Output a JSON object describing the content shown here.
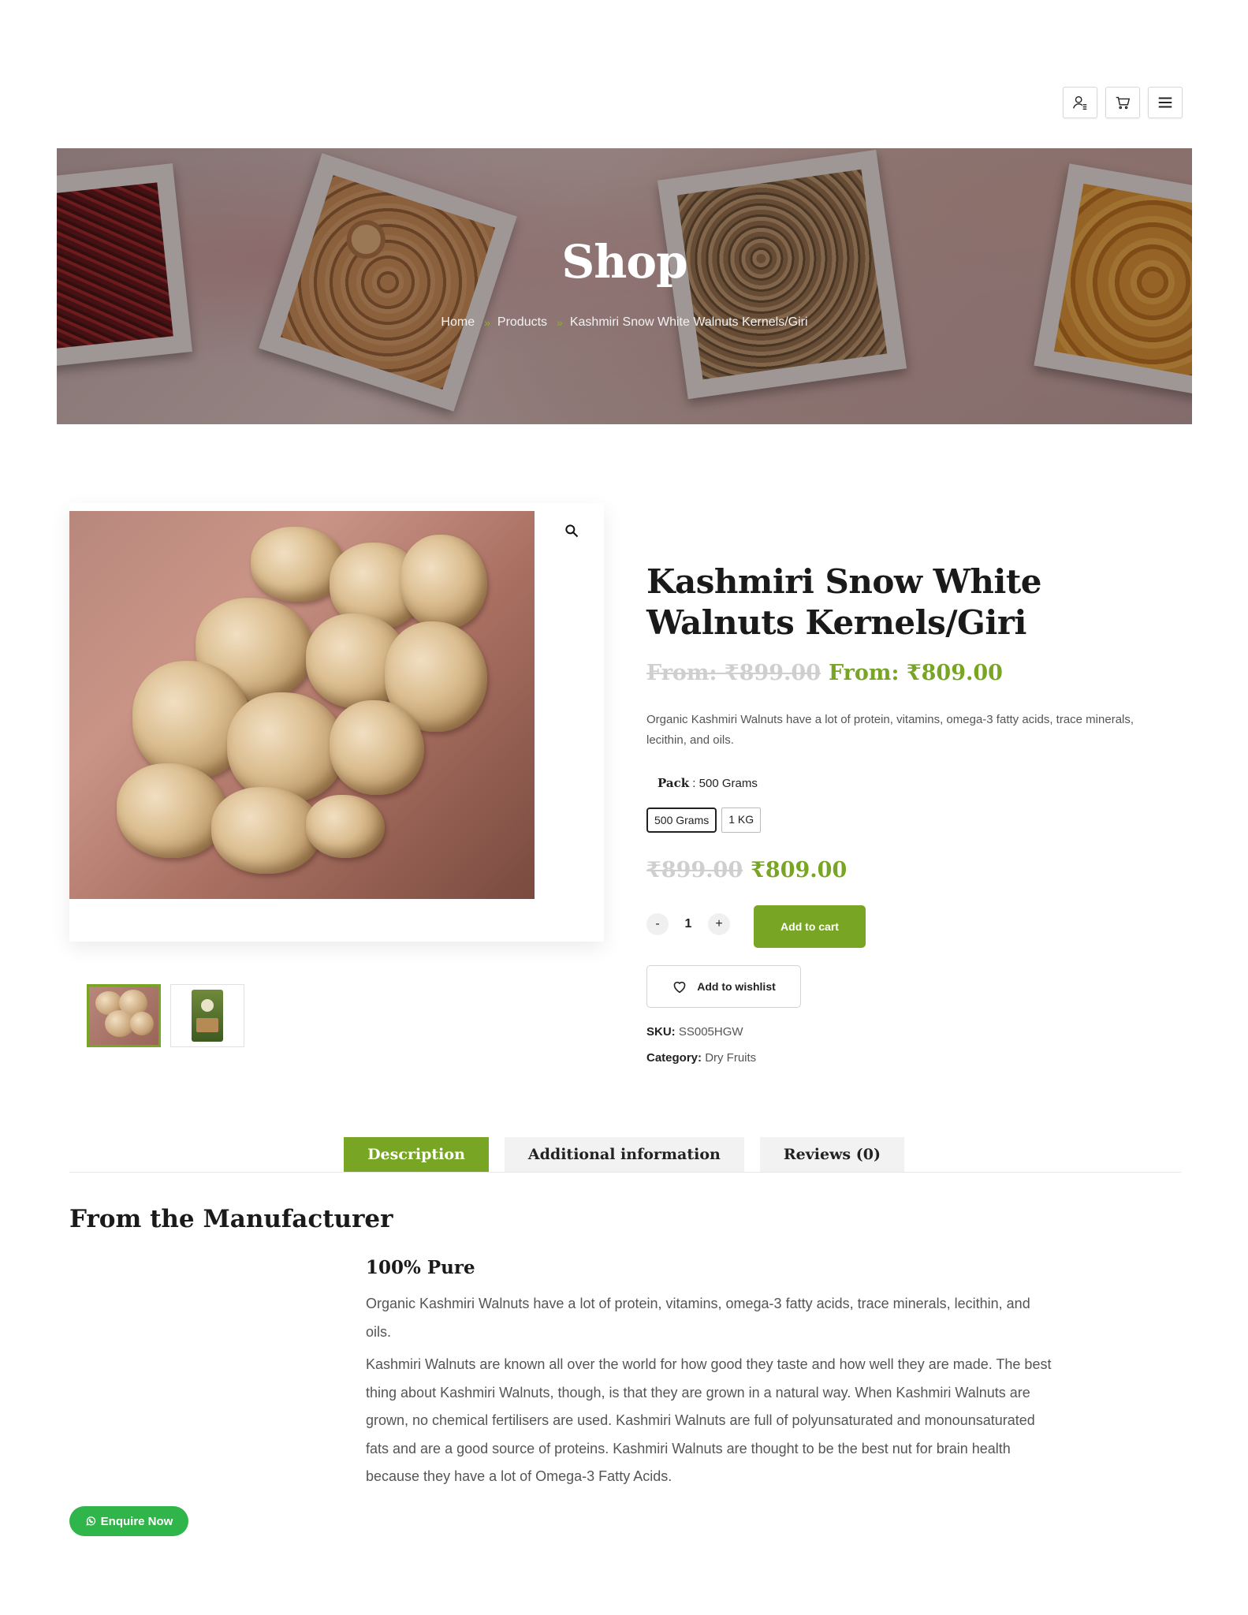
{
  "header": {
    "icons": [
      "user-menu-icon",
      "cart-icon",
      "hamburger-menu-icon"
    ]
  },
  "banner": {
    "title": "Shop",
    "breadcrumb": [
      "Home",
      "Products",
      "Kashmiri Snow White Walnuts Kernels/Giri"
    ]
  },
  "product": {
    "title": "Kashmiri Snow White Walnuts Kernels/Giri",
    "price_range_old": "From: ₹899.00",
    "price_range_new": "From: ₹809.00",
    "short_description": "Organic Kashmiri Walnuts have a lot of protein, vitamins, omega-3 fatty acids, trace minerals, lecithin, and oils.",
    "pack_label": "Pack",
    "pack_selected": "500 Grams",
    "variants": [
      "500 Grams",
      "1 KG"
    ],
    "variant_price_old": "₹899.00",
    "variant_price_new": "₹809.00",
    "quantity": "1",
    "qty_minus": "-",
    "qty_plus": "+",
    "add_to_cart": "Add to cart",
    "add_to_wishlist": "Add to wishlist",
    "sku_label": "SKU:",
    "sku": "SS005HGW",
    "category_label": "Category:",
    "category": "Dry Fruits"
  },
  "tabs": [
    "Description",
    "Additional information",
    "Reviews (0)"
  ],
  "description": {
    "heading": "From the Manufacturer",
    "subheading": "100% Pure",
    "paragraph1": "Organic Kashmiri Walnuts have a lot of protein, vitamins, omega-3 fatty acids, trace minerals, lecithin, and oils.",
    "paragraph2": "Kashmiri Walnuts are known all over the world for how good they taste and how well they are made. The best thing about Kashmiri Walnuts, though, is that they are grown in a natural way. When Kashmiri Walnuts are grown, no chemical fertilisers are used. Kashmiri Walnuts are full of polyunsaturated and monounsaturated fats and are a good source of proteins. Kashmiri Walnuts are thought to be the best nut for brain health because they have a lot of Omega-3 Fatty Acids."
  },
  "enquire_button": "Enquire Now",
  "colors": {
    "accent": "#78a624",
    "whatsapp": "#2fb54a"
  }
}
